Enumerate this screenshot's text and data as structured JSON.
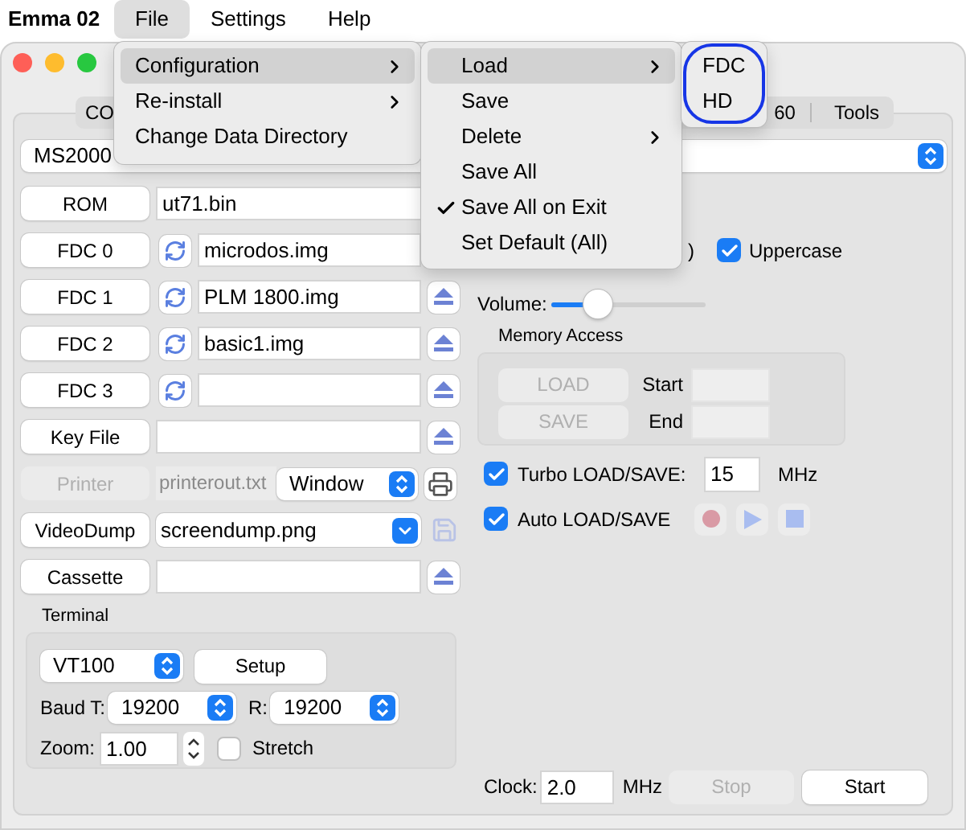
{
  "menubar": {
    "app": "Emma 02",
    "menus": [
      {
        "label": "File",
        "selected": true
      },
      {
        "label": "Settings",
        "selected": false
      },
      {
        "label": "Help",
        "selected": false
      }
    ]
  },
  "file_menu": {
    "items": [
      {
        "label": "Configuration",
        "submenu": true,
        "selected": true
      },
      {
        "label": "Re-install",
        "submenu": true,
        "selected": false
      },
      {
        "label": "Change Data Directory",
        "submenu": false,
        "selected": false
      }
    ]
  },
  "configuration_menu": {
    "items": [
      {
        "label": "Load",
        "submenu": true,
        "checked": false,
        "selected": true
      },
      {
        "label": "Save",
        "submenu": false,
        "checked": false,
        "selected": false
      },
      {
        "label": "Delete",
        "submenu": true,
        "checked": false,
        "selected": false
      },
      {
        "label": "Save All",
        "submenu": false,
        "checked": false,
        "selected": false
      },
      {
        "label": "Save All on Exit",
        "submenu": false,
        "checked": true,
        "selected": false
      },
      {
        "label": "Set Default (All)",
        "submenu": false,
        "checked": false,
        "selected": false
      }
    ]
  },
  "load_menu": {
    "circled": true,
    "items": [
      {
        "label": "FDC"
      },
      {
        "label": "HD"
      }
    ]
  },
  "tabs": [
    {
      "label": "CO",
      "selected": false
    },
    {
      "label": "60",
      "selected": false
    },
    {
      "label": "Tools",
      "selected": false
    }
  ],
  "machine_select": {
    "value": "MS2000"
  },
  "file_rows": [
    {
      "kind": "plain",
      "button": "ROM",
      "value": "ut71.bin"
    },
    {
      "kind": "covered_drive",
      "button": "FDC 0",
      "value": "microdos.img"
    },
    {
      "kind": "drive",
      "button": "FDC 1",
      "value": "PLM 1800.img"
    },
    {
      "kind": "drive",
      "button": "FDC 2",
      "value": "basic1.img"
    },
    {
      "kind": "drive",
      "button": "FDC 3",
      "value": ""
    },
    {
      "kind": "file",
      "button": "Key File",
      "value": ""
    },
    {
      "kind": "printer",
      "button": "Printer",
      "value": "printerout.txt",
      "mode": "Window"
    },
    {
      "kind": "dump",
      "button": "VideoDump",
      "value": "screendump.png"
    },
    {
      "kind": "file",
      "button": "Cassette",
      "value": ""
    }
  ],
  "terminal": {
    "title": "Terminal",
    "type": "VT100",
    "setup": "Setup",
    "baud_t_label": "Baud T:",
    "baud_t": "19200",
    "baud_r_label": "R:",
    "baud_r": "19200",
    "zoom_label": "Zoom:",
    "zoom": "1.00",
    "stretch": {
      "label": "Stretch",
      "checked": false
    }
  },
  "partial_label": ")",
  "uppercase": {
    "label": "Uppercase",
    "checked": true
  },
  "volume": {
    "label": "Volume:",
    "level": 0.3
  },
  "memory_access": {
    "title": "Memory Access",
    "load": "LOAD",
    "save": "SAVE",
    "disabled": true,
    "start_label": "Start",
    "end_label": "End"
  },
  "turbo": {
    "label": "Turbo LOAD/SAVE:",
    "checked": true,
    "value": "15",
    "unit": "MHz"
  },
  "auto": {
    "label": "Auto LOAD/SAVE",
    "checked": true
  },
  "clock": {
    "label": "Clock:",
    "value": "2.0",
    "unit": "MHz",
    "stop": "Stop",
    "stop_disabled": true,
    "start": "Start"
  }
}
